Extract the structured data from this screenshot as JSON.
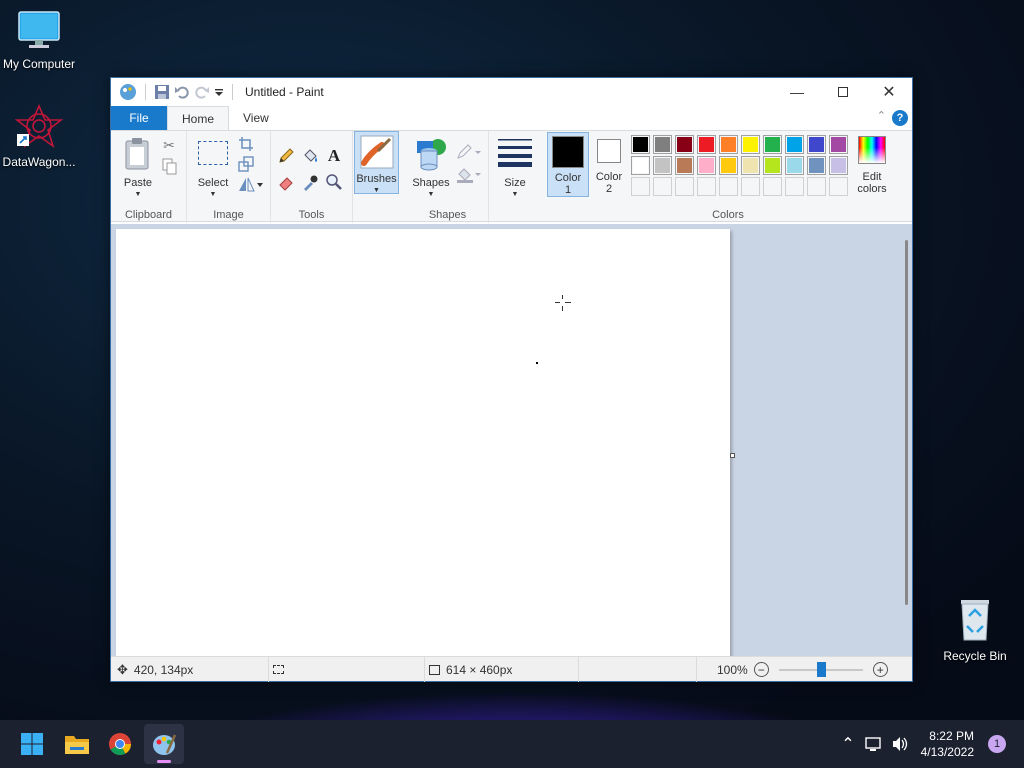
{
  "desktop": {
    "icons": [
      {
        "label": "My Computer"
      },
      {
        "label": "DataWagon..."
      },
      {
        "label": "Recycle Bin"
      }
    ]
  },
  "window": {
    "title": "Untitled - Paint",
    "tabs": [
      "File",
      "Home",
      "View"
    ],
    "help": "?"
  },
  "ribbon": {
    "clipboard": {
      "label": "Clipboard",
      "paste": "Paste"
    },
    "image": {
      "label": "Image",
      "select": "Select"
    },
    "tools": {
      "label": "Tools"
    },
    "brushes": {
      "label": "Brushes"
    },
    "shapes": {
      "label": "Shapes",
      "button": "Shapes"
    },
    "size": {
      "label": "Size"
    },
    "colors": {
      "label": "Colors",
      "color1": "Color\n1",
      "color1_line1": "Color",
      "color1_line2": "1",
      "color2_line1": "Color",
      "color2_line2": "2",
      "edit_line1": "Edit",
      "edit_line2": "colors",
      "color1_value": "#000000",
      "color2_value": "#ffffff",
      "palette_row1": [
        "#000000",
        "#7f7f7f",
        "#880015",
        "#ed1c24",
        "#ff7f27",
        "#fff200",
        "#22b14c",
        "#00a2e8",
        "#3f48cc",
        "#a349a4"
      ],
      "palette_row2": [
        "#ffffff",
        "#c3c3c3",
        "#b97a57",
        "#ffaec9",
        "#ffc90e",
        "#efe4b0",
        "#b5e61d",
        "#99d9ea",
        "#7092be",
        "#c8bfe7"
      ]
    }
  },
  "status": {
    "cursor": "420, 134px",
    "canvas_size": "614 × 460px",
    "zoom": "100%"
  },
  "taskbar": {
    "time": "8:22 PM",
    "date": "4/13/2022",
    "notifications": "1"
  }
}
